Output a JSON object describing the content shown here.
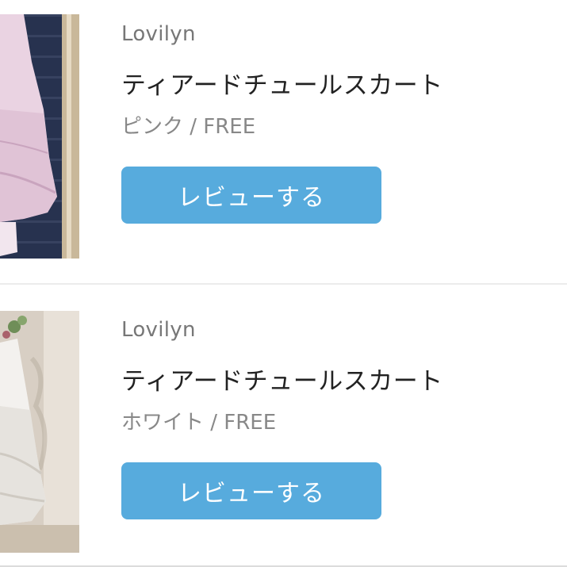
{
  "items": [
    {
      "brand": "Lovilyn",
      "title": "ティアードチュールスカート",
      "variant": "ピンク / FREE",
      "review_label": "レビューする",
      "thumbnail": "pink-tiered-tulle-skirt-photo"
    },
    {
      "brand": "Lovilyn",
      "title": "ティアードチュールスカート",
      "variant": "ホワイト / FREE",
      "review_label": "レビューする",
      "thumbnail": "white-tiered-tulle-skirt-photo"
    }
  ],
  "colors": {
    "button": "#57abdd",
    "button_text": "#ffffff",
    "brand_text": "#777777",
    "variant_text": "#888888",
    "divider": "#ececec"
  }
}
